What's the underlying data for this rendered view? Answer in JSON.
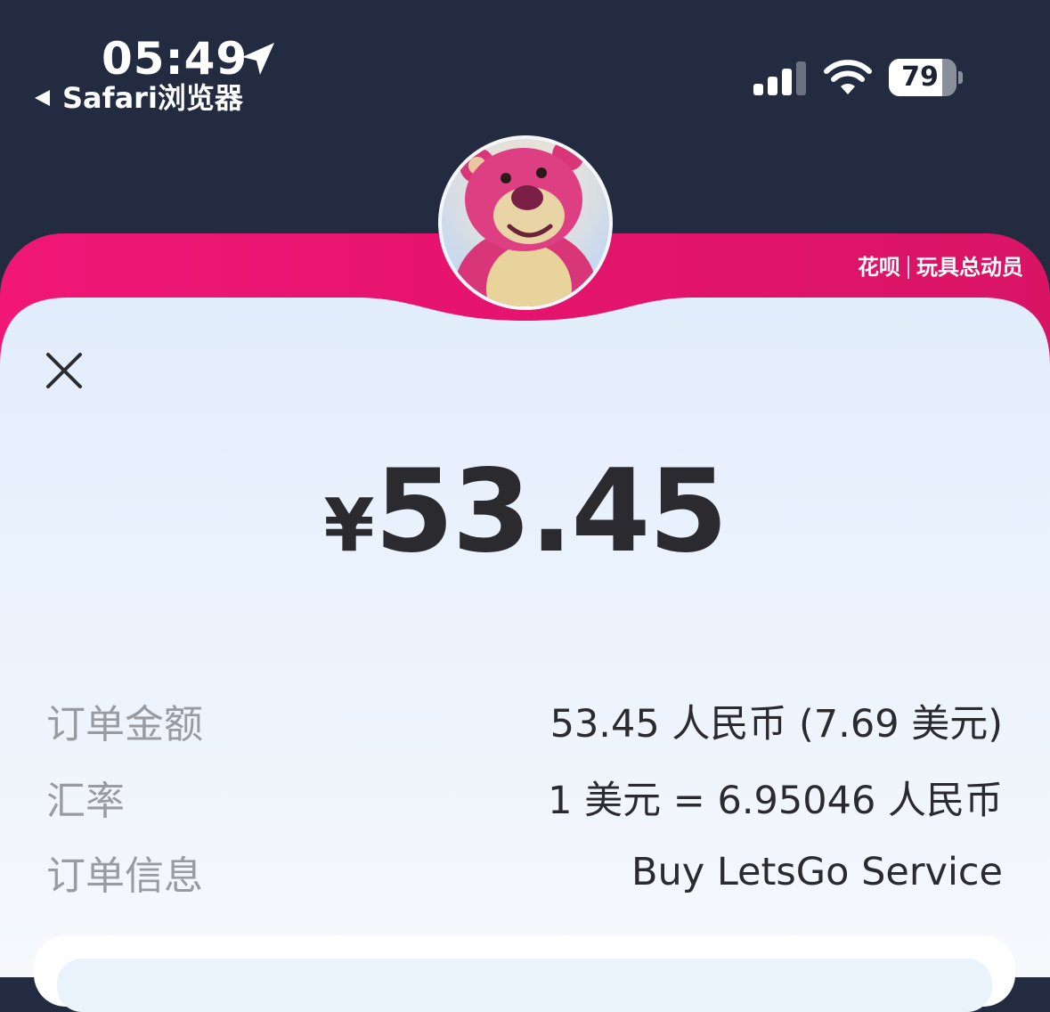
{
  "status_bar": {
    "time": "05:49",
    "back_app": "Safari浏览器",
    "battery_level": "79",
    "battery_percent": 79,
    "signal_bars_active": 3
  },
  "banner": {
    "brand": "花呗",
    "campaign": "玩具总动员",
    "colors": {
      "banner": "#e6146e",
      "header_bg": "#232b40",
      "sheet_top": "#e3eefb",
      "sheet_bottom": "#f5f8fc"
    }
  },
  "payment": {
    "currency_symbol": "¥",
    "amount": "53.45"
  },
  "details": [
    {
      "label": "订单金额",
      "value": "53.45 人民币 (7.69 美元)"
    },
    {
      "label": "汇率",
      "value": "1 美元 = 6.95046 人民币"
    },
    {
      "label": "订单信息",
      "value": "Buy LetsGo Service"
    }
  ],
  "icons": {
    "close": "close-icon",
    "location": "location-arrow-icon",
    "back": "back-triangle-icon",
    "signal": "cellular-signal-icon",
    "wifi": "wifi-icon",
    "battery": "battery-icon",
    "avatar": "pink-bear-avatar"
  }
}
